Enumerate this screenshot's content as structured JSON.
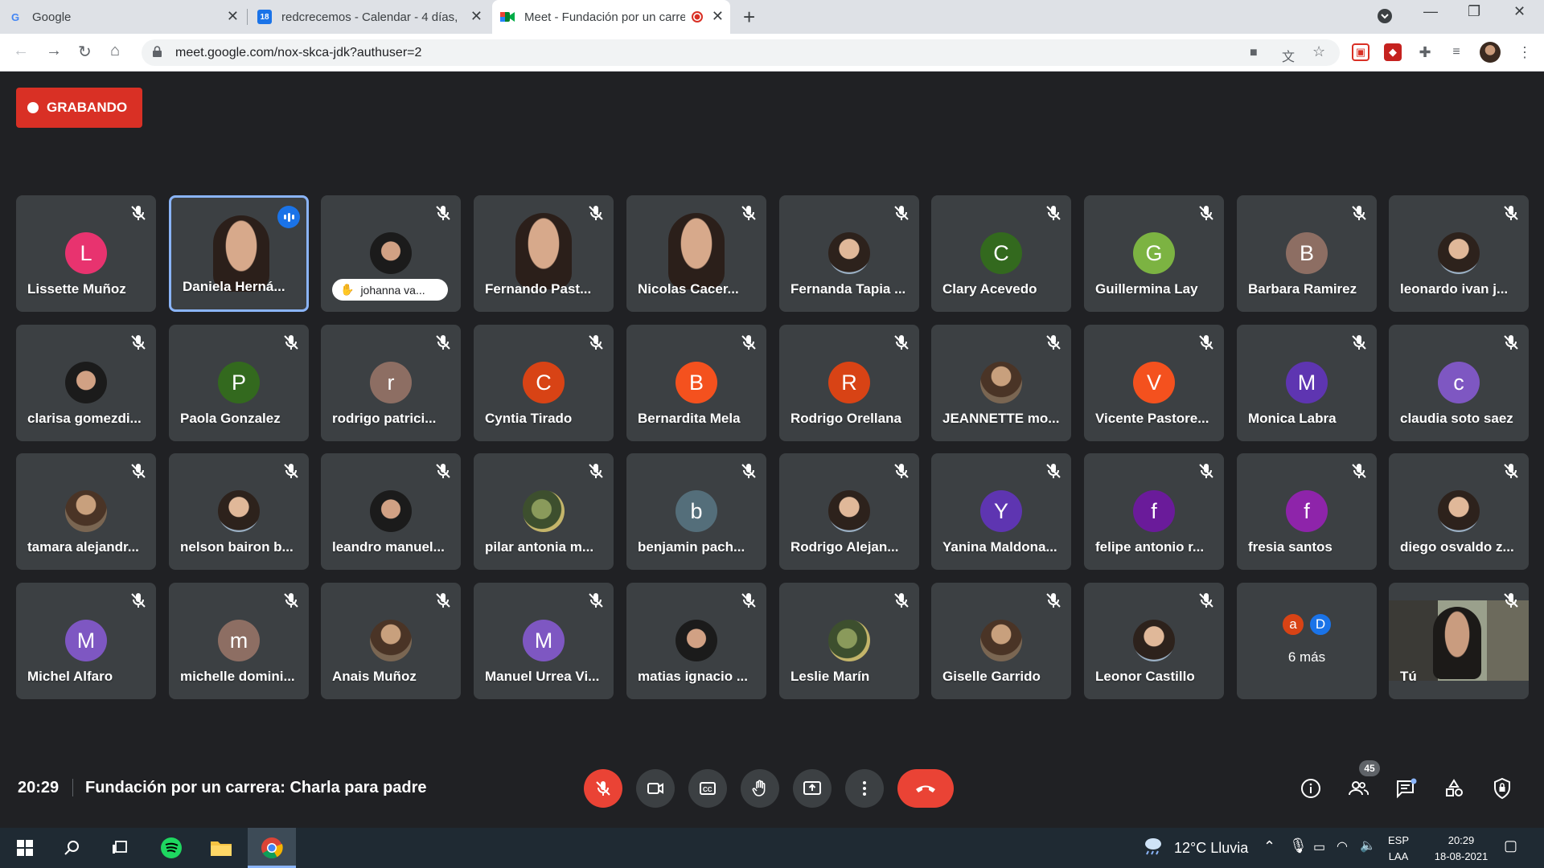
{
  "browser": {
    "tabs": [
      {
        "title": "Google",
        "favicon": "G"
      },
      {
        "title": "redcrecemos - Calendar - 4 días,",
        "favicon": "18"
      },
      {
        "title": "Meet - Fundación por un carrera",
        "favicon": "meet"
      }
    ],
    "url": "meet.google.com/nox-skca-jdk?authuser=2"
  },
  "meet": {
    "recording_label": "GRABANDO",
    "time": "20:29",
    "meeting_title": "Fundación por un carrera: Charla para padre",
    "participant_count": "45",
    "colors": {
      "record_red": "#d93025",
      "end_call": "#ea4335",
      "tile": "#3c4043",
      "bg": "#202124",
      "speaking_blue": "#1a73e8"
    },
    "participants": [
      {
        "name": "Lissette Muñoz",
        "type": "letter",
        "letter": "L",
        "color": "#e8336f"
      },
      {
        "name": "Daniela Herná...",
        "type": "video",
        "speaking": true
      },
      {
        "name": "johanna va...",
        "type": "photo",
        "hand": true
      },
      {
        "name": "Fernando Past...",
        "type": "video"
      },
      {
        "name": "Nicolas Cacer...",
        "type": "video"
      },
      {
        "name": "Fernanda Tapia ...",
        "type": "photo"
      },
      {
        "name": "Clary Acevedo",
        "type": "letter",
        "letter": "C",
        "color": "#33691e"
      },
      {
        "name": "Guillermina Lay",
        "type": "letter",
        "letter": "G",
        "color": "#7cb342"
      },
      {
        "name": "Barbara Ramirez",
        "type": "letter",
        "letter": "B",
        "color": "#8d6e63"
      },
      {
        "name": "leonardo ivan j...",
        "type": "photo"
      },
      {
        "name": "clarisa gomezdi...",
        "type": "photo"
      },
      {
        "name": "Paola Gonzalez",
        "type": "letter",
        "letter": "P",
        "color": "#33691e"
      },
      {
        "name": "rodrigo patrici...",
        "type": "letter",
        "letter": "r",
        "color": "#8d6e63"
      },
      {
        "name": "Cyntia Tirado",
        "type": "letter",
        "letter": "C",
        "color": "#d84315"
      },
      {
        "name": "Bernardita Mela",
        "type": "letter",
        "letter": "B",
        "color": "#f4511e"
      },
      {
        "name": "Rodrigo Orellana",
        "type": "letter",
        "letter": "R",
        "color": "#d84315"
      },
      {
        "name": "JEANNETTE mo...",
        "type": "photo"
      },
      {
        "name": "Vicente Pastore...",
        "type": "letter",
        "letter": "V",
        "color": "#f4511e"
      },
      {
        "name": "Monica Labra",
        "type": "letter",
        "letter": "M",
        "color": "#5e35b1"
      },
      {
        "name": "claudia soto saez",
        "type": "letter",
        "letter": "c",
        "color": "#7e57c2"
      },
      {
        "name": "tamara alejandr...",
        "type": "photo"
      },
      {
        "name": "nelson bairon b...",
        "type": "photo"
      },
      {
        "name": "leandro manuel...",
        "type": "photo"
      },
      {
        "name": "pilar antonia m...",
        "type": "photo"
      },
      {
        "name": "benjamin pach...",
        "type": "letter",
        "letter": "b",
        "color": "#546e7a"
      },
      {
        "name": "Rodrigo Alejan...",
        "type": "photo"
      },
      {
        "name": "Yanina Maldona...",
        "type": "letter",
        "letter": "Y",
        "color": "#5e35b1"
      },
      {
        "name": "felipe antonio r...",
        "type": "letter",
        "letter": "f",
        "color": "#6a1b9a"
      },
      {
        "name": "fresia santos",
        "type": "letter",
        "letter": "f",
        "color": "#8e24aa"
      },
      {
        "name": "diego osvaldo z...",
        "type": "photo"
      },
      {
        "name": "Michel Alfaro",
        "type": "letter",
        "letter": "M",
        "color": "#7e57c2"
      },
      {
        "name": "michelle domini...",
        "type": "letter",
        "letter": "m",
        "color": "#8d6e63"
      },
      {
        "name": "Anais Muñoz",
        "type": "photo"
      },
      {
        "name": "Manuel Urrea Vi...",
        "type": "letter",
        "letter": "M",
        "color": "#7e57c2"
      },
      {
        "name": "matias ignacio ...",
        "type": "photo"
      },
      {
        "name": "Leslie Marín",
        "type": "photo"
      },
      {
        "name": "Giselle Garrido",
        "type": "photo"
      },
      {
        "name": "Leonor Castillo",
        "type": "photo"
      },
      {
        "name": "",
        "type": "more",
        "label": "6 más",
        "letters": [
          "a",
          "D"
        ],
        "colors": [
          "#d84315",
          "#1a73e8"
        ]
      },
      {
        "name": "Tú",
        "type": "self"
      }
    ],
    "controls": [
      {
        "name": "mic-off-button",
        "icon": "mic-off-icon"
      },
      {
        "name": "camera-button",
        "icon": "camera-icon"
      },
      {
        "name": "captions-button",
        "icon": "captions-icon"
      },
      {
        "name": "raise-hand-button",
        "icon": "hand-icon"
      },
      {
        "name": "present-button",
        "icon": "present-icon"
      },
      {
        "name": "more-options-button",
        "icon": "more-vert-icon"
      },
      {
        "name": "leave-call-button",
        "icon": "end-call-icon"
      }
    ]
  },
  "taskbar": {
    "weather": "12°C  Lluvia",
    "lang_1": "ESP",
    "lang_2": "LAA",
    "time": "20:29",
    "date": "18-08-2021"
  }
}
